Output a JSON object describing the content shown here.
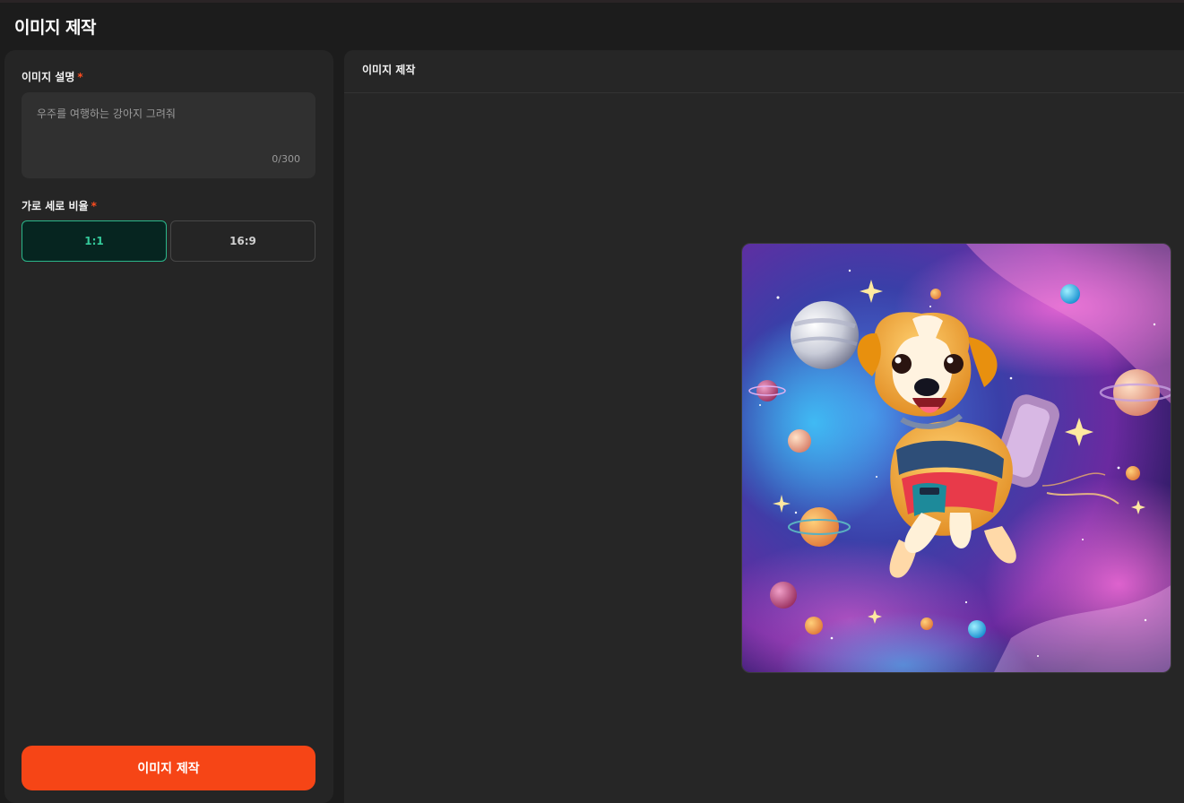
{
  "page": {
    "title": "이미지 제작"
  },
  "form": {
    "description_label": "이미지 설명",
    "required_mark": "*",
    "description_value": "",
    "description_placeholder": "우주를 여행하는 강아지 그려줘",
    "char_counter": "0/300",
    "ratio_label": "가로 세로 비율",
    "ratio_options": [
      {
        "label": "1:1",
        "selected": true
      },
      {
        "label": "16:9",
        "selected": false
      }
    ],
    "submit_label": "이미지 제작"
  },
  "result": {
    "header_title": "이미지 제작",
    "image_subject": "space-dog-illustration"
  },
  "colors": {
    "accent": "#f64516",
    "selected_border": "#2bb68a",
    "selected_text": "#34c99a",
    "required": "#ff4d1f"
  }
}
